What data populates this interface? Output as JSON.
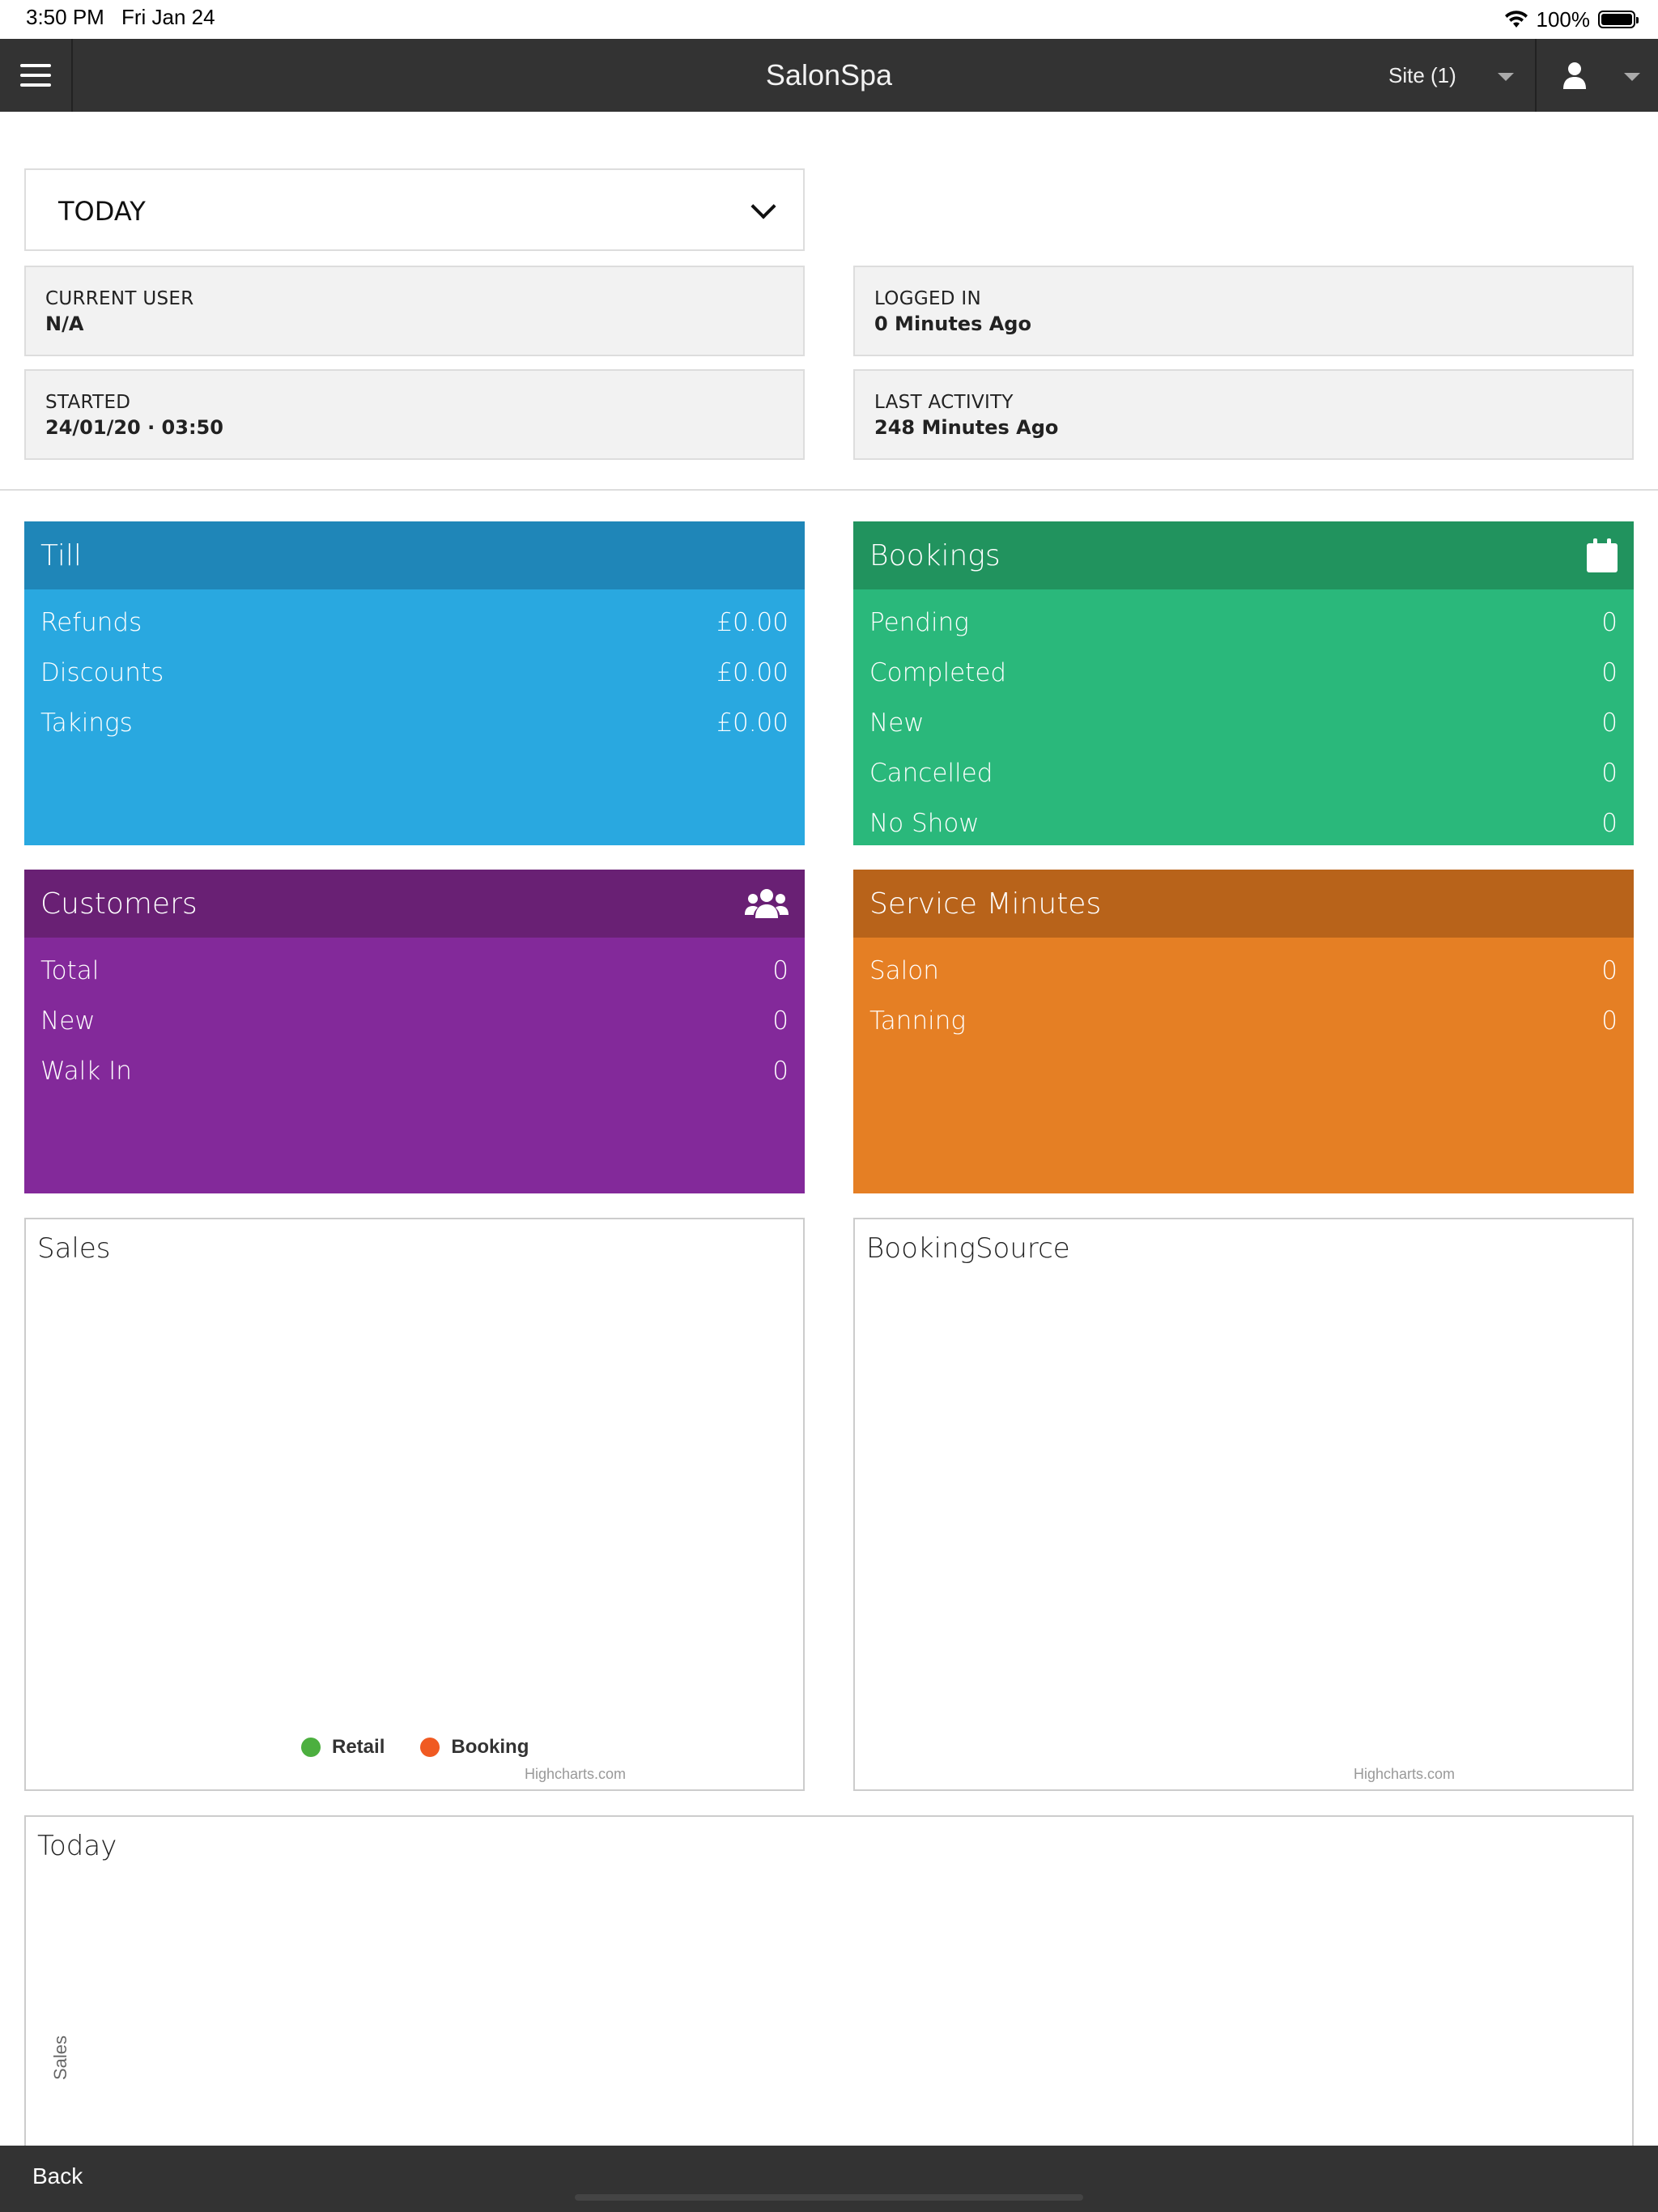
{
  "status_bar": {
    "time": "3:50 PM",
    "date": "Fri Jan 24",
    "battery": "100%"
  },
  "nav": {
    "title": "SalonSpa",
    "site_label": "Site (1)"
  },
  "period": {
    "value": "TODAY"
  },
  "info": {
    "current_user": {
      "label": "CURRENT USER",
      "value": "N/A"
    },
    "logged_in": {
      "label": "LOGGED IN",
      "value": "0 Minutes Ago"
    },
    "started": {
      "label": "STARTED",
      "value": "24/01/20 · 03:50"
    },
    "last_activity": {
      "label": "LAST ACTIVITY",
      "value": "248 Minutes Ago"
    }
  },
  "tiles": {
    "till": {
      "title": "Till",
      "rows": [
        {
          "label": "Refunds",
          "value": "£0.00"
        },
        {
          "label": "Discounts",
          "value": "£0.00"
        },
        {
          "label": "Takings",
          "value": "£0.00"
        }
      ]
    },
    "bookings": {
      "title": "Bookings",
      "icon": "calendar-icon",
      "rows": [
        {
          "label": "Pending",
          "value": "0"
        },
        {
          "label": "Completed",
          "value": "0"
        },
        {
          "label": "New",
          "value": "0"
        },
        {
          "label": "Cancelled",
          "value": "0"
        },
        {
          "label": "No Show",
          "value": "0"
        }
      ]
    },
    "customers": {
      "title": "Customers",
      "icon": "users-icon",
      "rows": [
        {
          "label": "Total",
          "value": "0"
        },
        {
          "label": "New",
          "value": "0"
        },
        {
          "label": "Walk In",
          "value": "0"
        }
      ]
    },
    "service_minutes": {
      "title": "Service Minutes",
      "rows": [
        {
          "label": "Salon",
          "value": "0"
        },
        {
          "label": "Tanning",
          "value": "0"
        }
      ]
    }
  },
  "charts": {
    "sales": {
      "title": "Sales",
      "legend": [
        {
          "name": "Retail",
          "color": "#4caf3f"
        },
        {
          "name": "Booking",
          "color": "#f05a22"
        }
      ],
      "credits": "Highcharts.com"
    },
    "booking_source": {
      "title": "BookingSource",
      "credits": "Highcharts.com"
    },
    "today": {
      "title": "Today",
      "ylabel": "Sales"
    }
  },
  "footer": {
    "back_label": "Back"
  },
  "colors": {
    "nav_bg": "#333333",
    "till": "#29a8e0",
    "bookings": "#2ab87b",
    "customers": "#83299a",
    "service_minutes": "#e57f24"
  }
}
